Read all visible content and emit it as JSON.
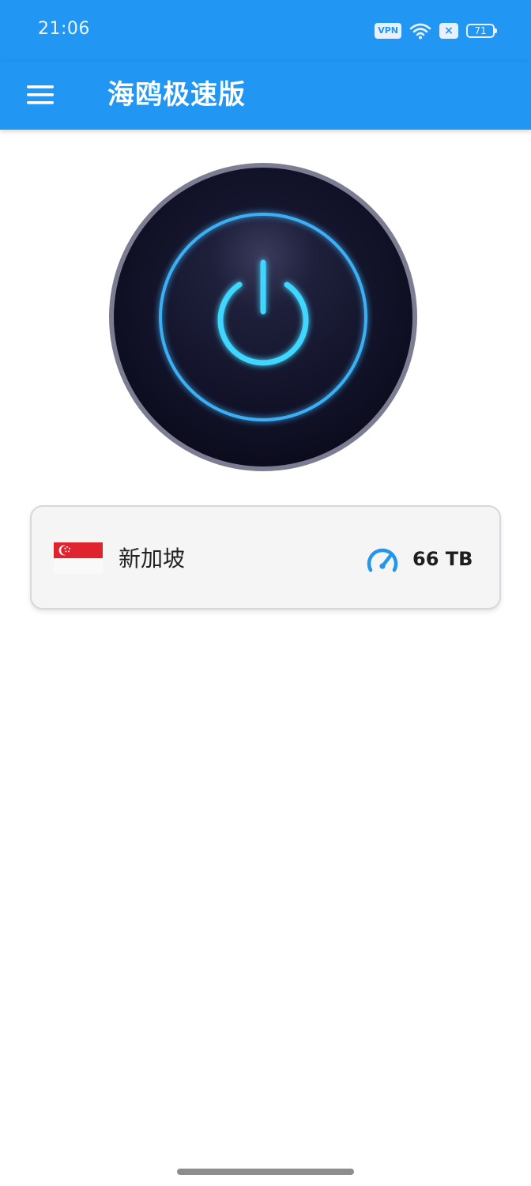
{
  "status_bar": {
    "time": "21:06",
    "vpn_label": "VPN",
    "battery_level": "71"
  },
  "app_bar": {
    "title": "海鸥极速版",
    "menu_icon": "hamburger-menu-icon"
  },
  "power_button": {
    "icon": "power-icon",
    "glow_color": "#3fd6ff"
  },
  "server": {
    "flag_icon": "singapore-flag-icon",
    "country": "新加坡",
    "speed_icon": "speedometer-icon",
    "traffic": "66 TB"
  },
  "colors": {
    "primary": "#2196f3",
    "accent_glow": "#3fd6ff",
    "button_dark": "#12122a"
  }
}
